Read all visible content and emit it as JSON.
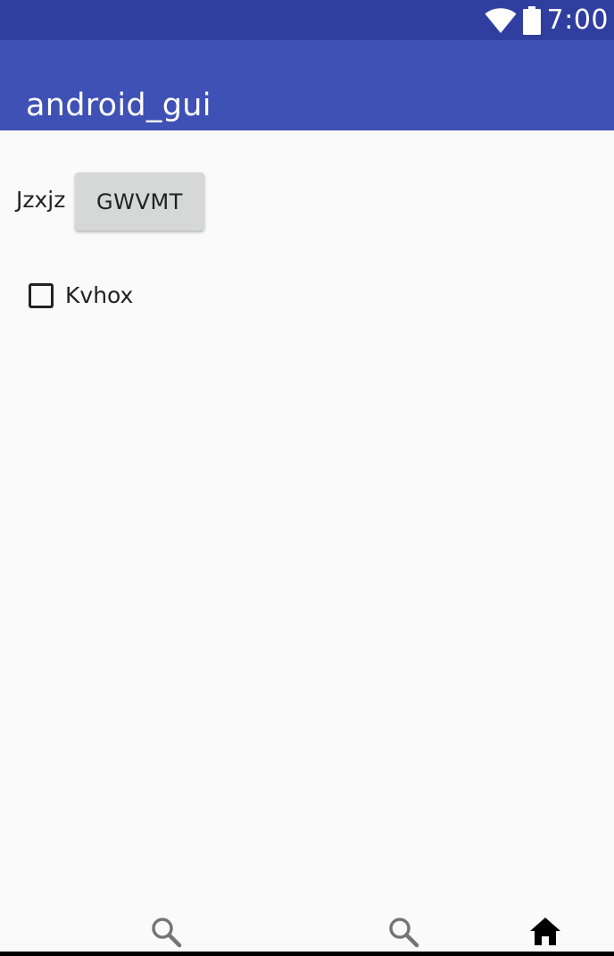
{
  "status_bar": {
    "time": "7:00",
    "background": "#303f9f"
  },
  "app_bar": {
    "title": "android_gui",
    "background": "#3f51b5"
  },
  "main": {
    "row_label": "Jzxjz",
    "button_label": "GWVMT",
    "checkbox": {
      "label": "Kvhox",
      "checked": false
    }
  },
  "bottom_nav": {
    "items": [
      {
        "icon": "search-icon"
      },
      {
        "icon": "search-icon"
      },
      {
        "icon": "home-icon",
        "selected": true
      }
    ]
  }
}
